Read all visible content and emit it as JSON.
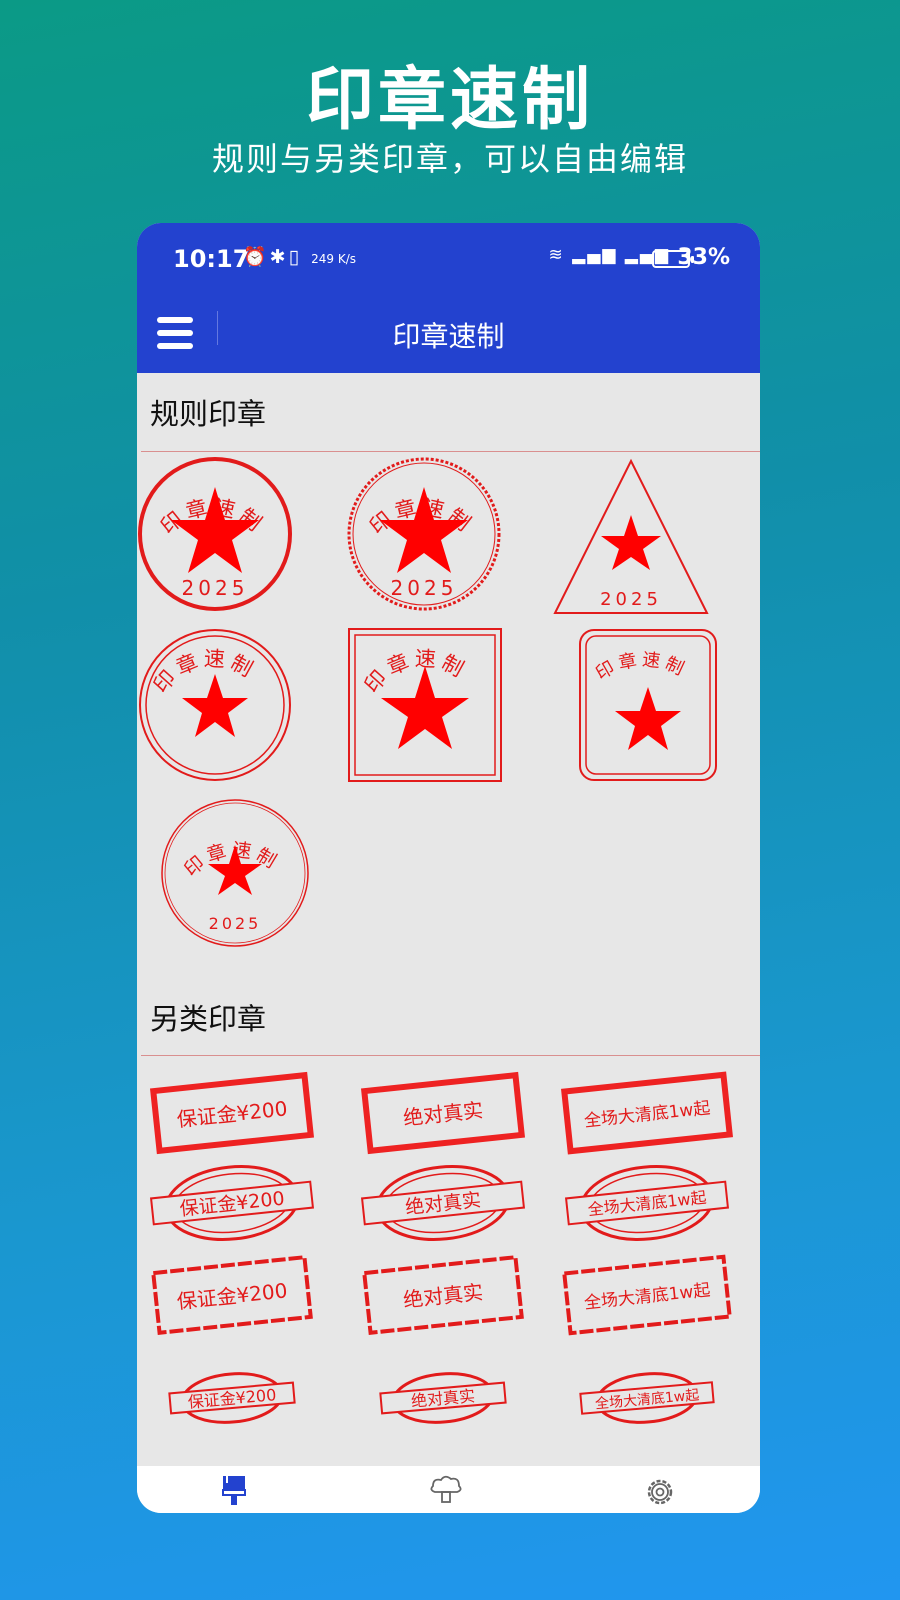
{
  "promo": {
    "title": "印章速制",
    "subtitle": "规则与另类印章，可以自由编辑"
  },
  "status_bar": {
    "time": "10:17",
    "speed": "249 K/s",
    "battery": "33%"
  },
  "app_bar": {
    "title": "印章速制"
  },
  "sections": {
    "regular": {
      "title": "规则印章",
      "seal_text": "印章速制",
      "seal_year": "2025"
    },
    "novelty": {
      "title": "另类印章",
      "texts": [
        "保证金¥200",
        "绝对真实",
        "全场大清底1w起"
      ]
    }
  },
  "colors": {
    "app_blue": "#2342cf",
    "seal_red": "#e21b1b",
    "content_bg": "#e7e7e7"
  },
  "tabs": [
    {
      "icon": "brush-icon"
    },
    {
      "icon": "stamp-icon"
    },
    {
      "icon": "gear-icon"
    }
  ]
}
